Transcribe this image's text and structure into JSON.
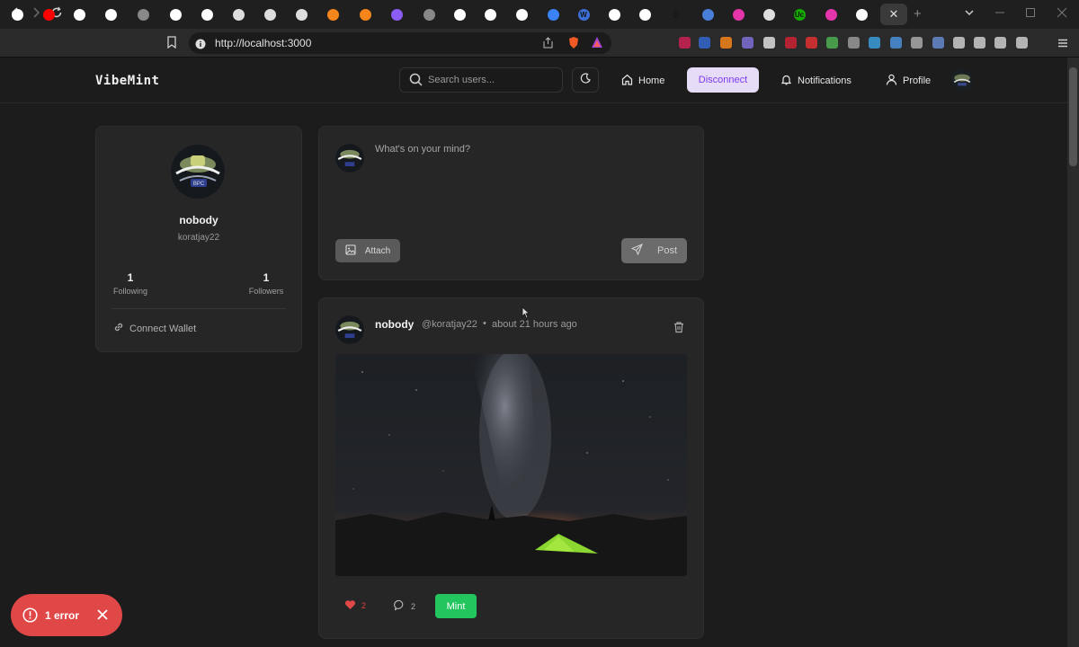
{
  "browser": {
    "url": "http://localhost:3000",
    "tabs": [
      {
        "icon": "github-icon",
        "glyph": "",
        "bg": "#ffffff"
      },
      {
        "icon": "youtube-icon",
        "glyph": "",
        "bg": "#ff0000"
      },
      {
        "icon": "github-icon",
        "glyph": "",
        "bg": "#ffffff"
      },
      {
        "icon": "github-icon",
        "glyph": "",
        "bg": "#ffffff"
      },
      {
        "icon": "dash-icon",
        "glyph": "",
        "bg": "#888888"
      },
      {
        "icon": "github-icon",
        "glyph": "",
        "bg": "#ffffff"
      },
      {
        "icon": "github-icon",
        "glyph": "",
        "bg": "#ffffff"
      },
      {
        "icon": "triangle-icon",
        "glyph": "",
        "bg": "#dddddd"
      },
      {
        "icon": "triangle-icon",
        "glyph": "",
        "bg": "#dddddd"
      },
      {
        "icon": "triangle-icon",
        "glyph": "",
        "bg": "#dddddd"
      },
      {
        "icon": "metamask-icon",
        "glyph": "",
        "bg": "#f6851b"
      },
      {
        "icon": "metamask-icon",
        "glyph": "",
        "bg": "#f6851b"
      },
      {
        "icon": "crescent-icon",
        "glyph": "",
        "bg": "#8b5cf6"
      },
      {
        "icon": "dash-icon",
        "glyph": "",
        "bg": "#888888"
      },
      {
        "icon": "github-icon",
        "glyph": "",
        "bg": "#ffffff"
      },
      {
        "icon": "github-icon",
        "glyph": "",
        "bg": "#ffffff"
      },
      {
        "icon": "github-icon",
        "glyph": "",
        "bg": "#ffffff"
      },
      {
        "icon": "blue-dot-icon",
        "glyph": "",
        "bg": "#3b82f6"
      },
      {
        "icon": "w-icon",
        "glyph": "W",
        "bg": "#3b6fd6"
      },
      {
        "icon": "github-icon",
        "glyph": "",
        "bg": "#ffffff"
      },
      {
        "icon": "github-icon",
        "glyph": "",
        "bg": "#ffffff"
      },
      {
        "icon": "d-icon",
        "glyph": "D",
        "bg": "#1f1f1f"
      },
      {
        "icon": "globe-icon",
        "glyph": "",
        "bg": "#4a7fd9"
      },
      {
        "icon": "graphql-icon",
        "glyph": "",
        "bg": "#e535ab"
      },
      {
        "icon": "chrome-icon",
        "glyph": "",
        "bg": "#dddddd"
      },
      {
        "icon": "upwork-icon",
        "glyph": "Uc",
        "bg": "#14a800"
      },
      {
        "icon": "graphql-icon",
        "glyph": "",
        "bg": "#e535ab"
      },
      {
        "icon": "github-icon",
        "glyph": "",
        "bg": "#ffffff"
      }
    ],
    "active_tab_close": "✕",
    "new_tab": "+"
  },
  "header": {
    "brand": "VibeMint",
    "search_placeholder": "Search users...",
    "nav": {
      "home": "Home",
      "disconnect": "Disconnect",
      "notifications": "Notifications",
      "profile": "Profile"
    }
  },
  "profile": {
    "name": "nobody",
    "handle": "koratjay22",
    "following_count": "1",
    "following_label": "Following",
    "followers_count": "1",
    "followers_label": "Followers",
    "connect_wallet": "Connect Wallet"
  },
  "composer": {
    "placeholder": "What's on your mind?",
    "attach": "Attach",
    "post": "Post"
  },
  "post": {
    "author": "nobody",
    "handle": "@koratjay22",
    "separator": "•",
    "time": "about 21 hours ago",
    "likes": "2",
    "comments": "2",
    "mint": "Mint"
  },
  "error_toast": {
    "text": "1 error"
  },
  "colors": {
    "accent_purple": "#7c3aed",
    "disconnect_bg": "#e6dcf7",
    "mint_green": "#22c55e",
    "error_red": "#e04848"
  }
}
